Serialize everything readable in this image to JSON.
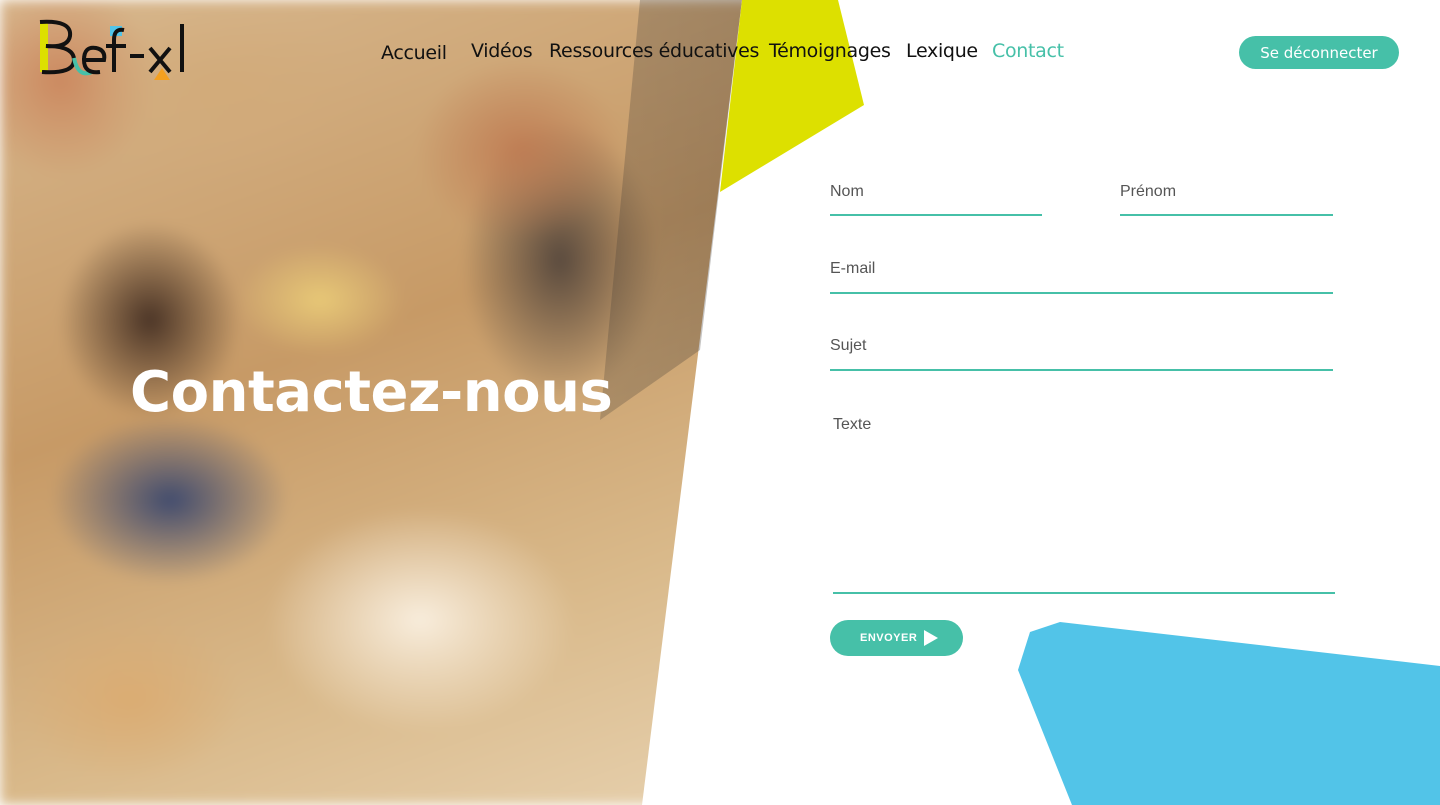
{
  "brand": {
    "logo_text": "Bef-xl",
    "colors": {
      "teal": "#46c0a8",
      "yellow": "#dde000",
      "blue": "#52c4e8",
      "black": "#111111"
    }
  },
  "nav": {
    "items": [
      {
        "label": "Accueil",
        "active": false
      },
      {
        "label": "Vidéos",
        "active": false
      },
      {
        "label": "Ressources éducatives",
        "active": false
      },
      {
        "label": "Témoignages",
        "active": false
      },
      {
        "label": "Lexique",
        "active": false
      },
      {
        "label": "Contact",
        "active": true
      }
    ],
    "logout_label": "Se déconnecter"
  },
  "hero": {
    "title": "Contactez-nous"
  },
  "form": {
    "nom_label": "Nom",
    "prenom_label": "Prénom",
    "email_label": "E-mail",
    "sujet_label": "Sujet",
    "texte_label": "Texte",
    "submit_label": "ENVOYER",
    "submit_icon": "play-icon"
  }
}
